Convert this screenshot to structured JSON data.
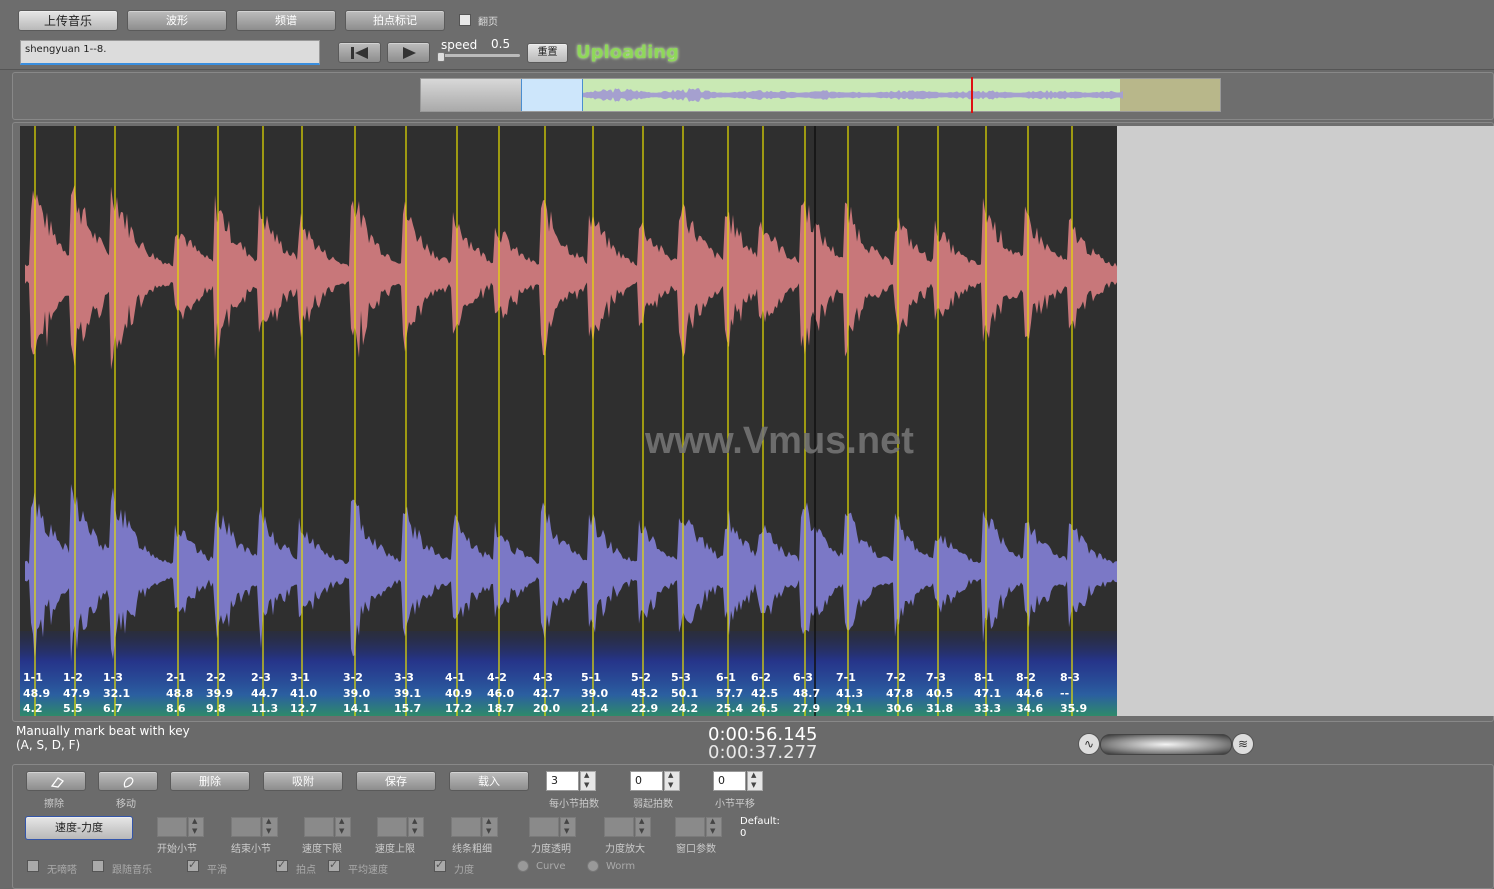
{
  "toolbar": {
    "upload_label": "上传音乐",
    "waveform_label": "波形",
    "spectrum_label": "频谱",
    "beatmark_label": "拍点标记",
    "pageturn_label": "翻页",
    "filename": "shengyuan 1--8.",
    "speed_label": "speed",
    "speed_value": "0.5",
    "reset_label": "重置",
    "status_text": "Uploading"
  },
  "watermark": "www.Vmus.net",
  "beats": [
    {
      "name": "1-1",
      "v1": "48.9",
      "v2": "4.2"
    },
    {
      "name": "1-2",
      "v1": "47.9",
      "v2": "5.5"
    },
    {
      "name": "1-3",
      "v1": "32.1",
      "v2": "6.7"
    },
    {
      "name": "2-1",
      "v1": "48.8",
      "v2": "8.6"
    },
    {
      "name": "2-2",
      "v1": "39.9",
      "v2": "9.8"
    },
    {
      "name": "2-3",
      "v1": "44.7",
      "v2": "11.3"
    },
    {
      "name": "3-1",
      "v1": "41.0",
      "v2": "12.7"
    },
    {
      "name": "3-2",
      "v1": "39.0",
      "v2": "14.1"
    },
    {
      "name": "3-3",
      "v1": "39.1",
      "v2": "15.7"
    },
    {
      "name": "4-1",
      "v1": "40.9",
      "v2": "17.2"
    },
    {
      "name": "4-2",
      "v1": "46.0",
      "v2": "18.7"
    },
    {
      "name": "4-3",
      "v1": "42.7",
      "v2": "20.0"
    },
    {
      "name": "5-1",
      "v1": "39.0",
      "v2": "21.4"
    },
    {
      "name": "5-2",
      "v1": "45.2",
      "v2": "22.9"
    },
    {
      "name": "5-3",
      "v1": "50.1",
      "v2": "24.2"
    },
    {
      "name": "6-1",
      "v1": "57.7",
      "v2": "25.4"
    },
    {
      "name": "6-2",
      "v1": "42.5",
      "v2": "26.5"
    },
    {
      "name": "6-3",
      "v1": "48.7",
      "v2": "27.9"
    },
    {
      "name": "7-1",
      "v1": "41.3",
      "v2": "29.1"
    },
    {
      "name": "7-2",
      "v1": "47.8",
      "v2": "30.6"
    },
    {
      "name": "7-3",
      "v1": "40.5",
      "v2": "31.8"
    },
    {
      "name": "8-1",
      "v1": "47.1",
      "v2": "33.3"
    },
    {
      "name": "8-2",
      "v1": "44.6",
      "v2": "34.6"
    },
    {
      "name": "8-3",
      "v1": "--",
      "v2": "35.9"
    }
  ],
  "status": {
    "hint_line1": "Manually mark beat with key",
    "hint_line2": "(A, S, D, F)",
    "time_total": "0:00:56.145",
    "time_current": "0:00:37.277"
  },
  "controls": {
    "erase_label": "擦除",
    "move_label": "移动",
    "delete_label": "删除",
    "snap_label": "吸附",
    "save_label": "保存",
    "load_label": "载入",
    "beats_per_bar_label": "每小节拍数",
    "beats_per_bar_value": "3",
    "pickup_label": "弱起拍数",
    "pickup_value": "0",
    "bar_shift_label": "小节平移",
    "bar_shift_value": "0",
    "tempo_dynamics_label": "速度-力度",
    "start_bar_label": "开始小节",
    "end_bar_label": "结束小节",
    "tempo_min_label": "速度下限",
    "tempo_max_label": "速度上限",
    "line_width_label": "线条粗细",
    "dyn_alpha_label": "力度透明",
    "dyn_scale_label": "力度放大",
    "window_param_label": "窗口参数",
    "default_label": "Default:",
    "default_value": "0",
    "mute_label": "无嘀嗒",
    "follow_label": "跟随音乐",
    "smooth_label": "平滑",
    "beat_label": "拍点",
    "avg_tempo_label": "平均速度",
    "dynamics_label": "力度",
    "curve_label": "Curve",
    "worm_label": "Worm"
  }
}
